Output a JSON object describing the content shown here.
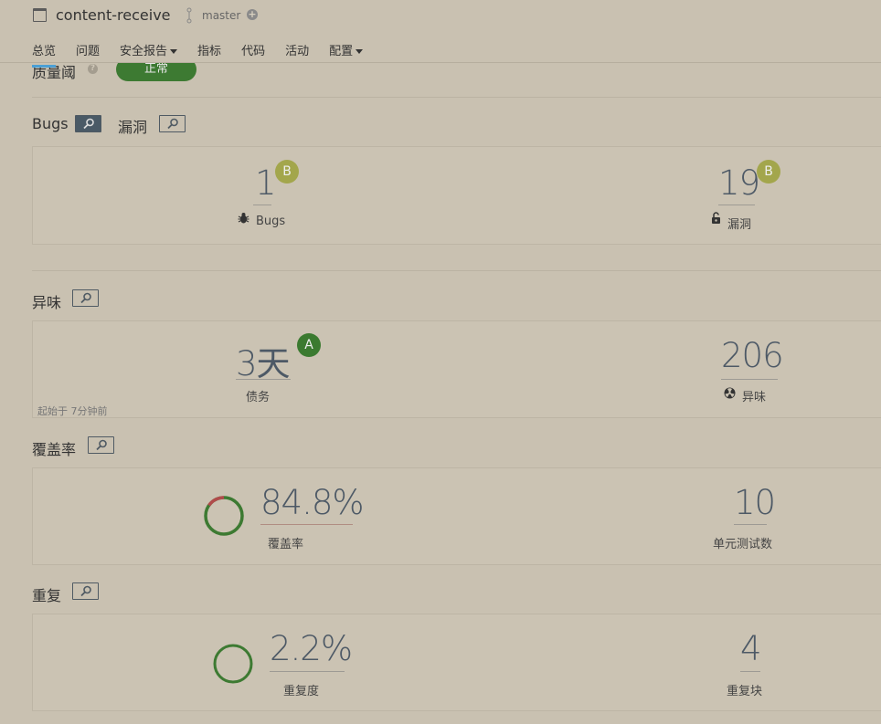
{
  "header": {
    "project_name": "content-receive",
    "branch": "master",
    "nav": [
      {
        "label": "总览",
        "active": true,
        "dropdown": false
      },
      {
        "label": "问题",
        "active": false,
        "dropdown": false
      },
      {
        "label": "安全报告",
        "active": false,
        "dropdown": true
      },
      {
        "label": "指标",
        "active": false,
        "dropdown": false
      },
      {
        "label": "代码",
        "active": false,
        "dropdown": false
      },
      {
        "label": "活动",
        "active": false,
        "dropdown": false
      },
      {
        "label": "配置",
        "active": false,
        "dropdown": true
      }
    ]
  },
  "quality_gate": {
    "title": "质量阈",
    "status": "正常",
    "status_color": "#3d7a32"
  },
  "bugs_section": {
    "title_bugs": "Bugs",
    "title_vuln": "漏洞",
    "bugs": {
      "value": "1",
      "rating": "B",
      "label": "Bugs",
      "icon": "bug-icon"
    },
    "vulnerabilities": {
      "value": "19",
      "rating": "B",
      "label": "漏洞",
      "icon": "unlock-icon"
    }
  },
  "smells_section": {
    "title": "异味",
    "debt": {
      "value": "3天",
      "rating": "A",
      "label": "债务"
    },
    "smells": {
      "value": "206",
      "label": "异味",
      "icon": "radiation-icon"
    },
    "since": "起始于 7分钟前"
  },
  "coverage_section": {
    "title": "覆盖率",
    "coverage": {
      "value": "84.8%",
      "label": "覆盖率",
      "percent": 84.8
    },
    "tests": {
      "value": "10",
      "label": "单元测试数"
    }
  },
  "duplication_section": {
    "title": "重复",
    "duplication": {
      "value": "2.2%",
      "label": "重复度",
      "percent": 2.2
    },
    "blocks": {
      "value": "4",
      "label": "重复块"
    }
  },
  "colors": {
    "background": "#c9c1b1",
    "rating_a": "#3b7a30",
    "rating_b": "#a3a64c",
    "text_value": "#4d5966"
  }
}
